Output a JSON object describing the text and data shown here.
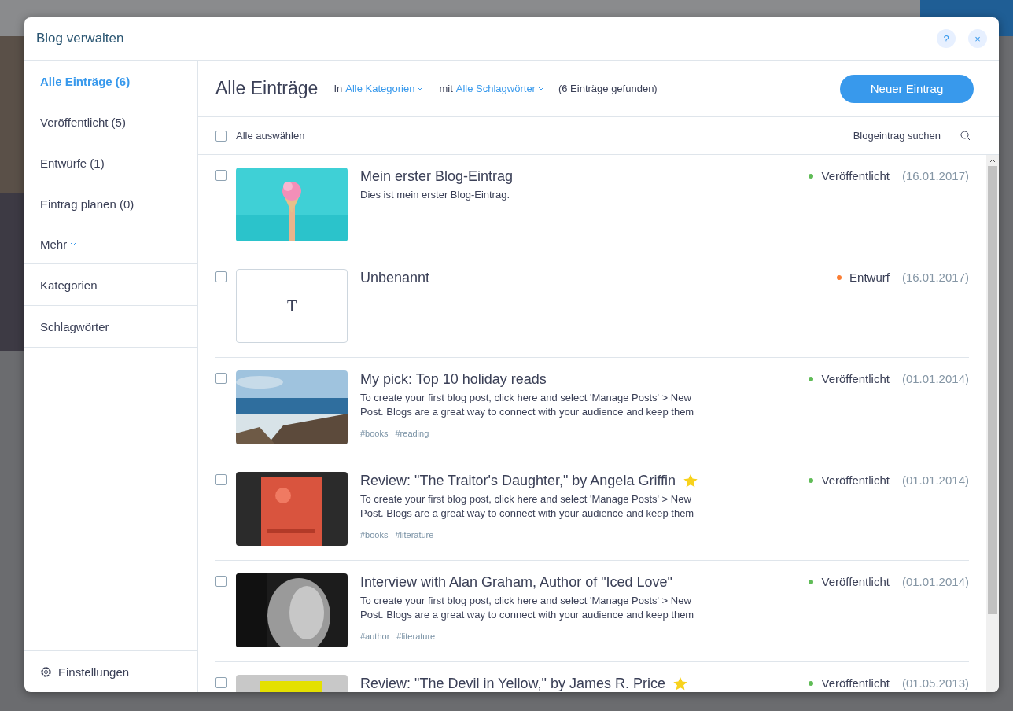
{
  "dialog": {
    "title": "Blog verwalten",
    "help_label": "?",
    "close_label": "×"
  },
  "sidebar": {
    "items": [
      {
        "label": "Alle Einträge (6)",
        "selected": true
      },
      {
        "label": "Veröffentlicht (5)",
        "selected": false
      },
      {
        "label": "Entwürfe (1)",
        "selected": false
      },
      {
        "label": "Eintrag planen (0)",
        "selected": false
      }
    ],
    "more": "Mehr",
    "sections": [
      "Kategorien",
      "Schlagwörter"
    ],
    "settings": "Einstellungen"
  },
  "header": {
    "title": "Alle Einträge",
    "category_prefix": "In",
    "category": "Alle Kategorien",
    "tag_prefix": "mit",
    "tag": "Alle Schlagwörter",
    "count": "(6 Einträge gefunden)",
    "new_button": "Neuer Eintrag"
  },
  "toolbar": {
    "select_all": "Alle auswählen",
    "select_all_checked": false,
    "search_placeholder": "Blogeintrag suchen"
  },
  "posts": [
    {
      "kind": "picture",
      "title": "Mein erster Blog-Eintrag",
      "featured": false,
      "excerpt": "Dies ist mein erster Blog-Eintrag.",
      "status": "Veröffentlicht",
      "color": "#60bc57",
      "date": "(16.01.2017)",
      "checked": false
    },
    {
      "kind": "text",
      "glyph": "T",
      "title": "Unbenannt",
      "featured": false,
      "status": "Entwurf",
      "color": "#fb7d33",
      "date": "(16.01.2017)",
      "checked": false
    },
    {
      "kind": "picture",
      "title": "My pick: Top 10 holiday reads",
      "featured": false,
      "excerpt": "To create your first blog post, click here and select 'Manage Posts' > New Post. Blogs are a great way to connect with your audience and keep them",
      "tags": [
        "#books",
        "#reading"
      ],
      "status": "Veröffentlicht",
      "color": "#60bc57",
      "date": "(01.01.2014)",
      "checked": false
    },
    {
      "kind": "picture",
      "title": "Review: \"The Traitor's Daughter,\" by Angela Griffin",
      "featured": true,
      "excerpt": "To create your first blog post, click here and select 'Manage Posts' > New Post. Blogs are a great way to connect with your audience and keep them",
      "tags": [
        "#books",
        "#literature"
      ],
      "status": "Veröffentlicht",
      "color": "#60bc57",
      "date": "(01.01.2014)",
      "checked": false
    },
    {
      "kind": "picture",
      "title": "Interview with Alan Graham, Author of \"Iced Love\"",
      "featured": false,
      "excerpt": "To create your first blog post, click here and select 'Manage Posts' > New Post. Blogs are a great way to connect with your audience and keep them",
      "tags": [
        "#author",
        "#literature"
      ],
      "status": "Veröffentlicht",
      "color": "#60bc57",
      "date": "(01.01.2014)",
      "checked": false
    },
    {
      "kind": "picture",
      "title": "Review: \"The Devil in Yellow,\" by James R. Price",
      "featured": true,
      "status": "Veröffentlicht",
      "color": "#60bc57",
      "date": "(01.05.2013)",
      "checked": false
    }
  ]
}
